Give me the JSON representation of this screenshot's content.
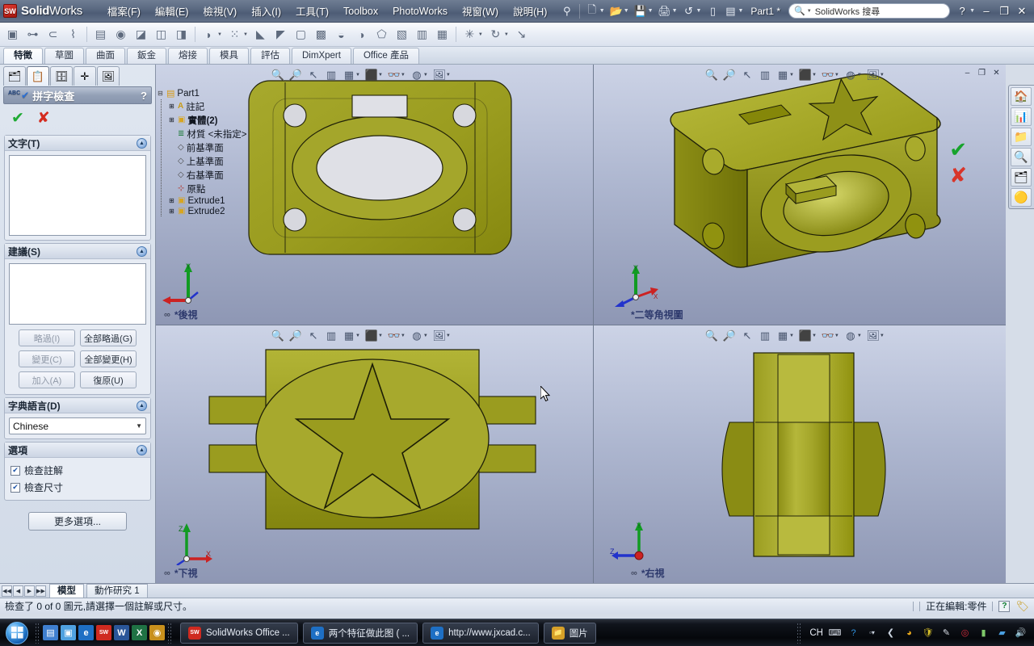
{
  "titlebar": {
    "brand_main": "Solid",
    "brand_light": "Works",
    "logo_text": "SW",
    "menus": [
      {
        "label": "檔案(F)"
      },
      {
        "label": "編輯(E)"
      },
      {
        "label": "檢視(V)"
      },
      {
        "label": "插入(I)"
      },
      {
        "label": "工具(T)"
      },
      {
        "label": "Toolbox"
      },
      {
        "label": "PhotoWorks"
      },
      {
        "label": "視窗(W)"
      },
      {
        "label": "說明(H)"
      }
    ],
    "doc_title": "Part1 *",
    "search_placeholder": "SolidWorks 搜尋",
    "search_value": "SolidWorks 搜尋",
    "quick_icons": [
      "pin-icon",
      "new-document-icon",
      "open-folder-icon",
      "save-icon",
      "print-icon",
      "undo-icon",
      "rebuild-icon",
      "options-icon"
    ],
    "help_label": "?",
    "minimize_label": "–",
    "restore_label": "❐",
    "close_label": "✕"
  },
  "command_toolbar": {
    "icons": [
      "extrude-boss-icon",
      "revolve-boss-icon",
      "swept-boss-icon",
      "lofted-boss-icon",
      "extruded-cut-icon",
      "hole-wizard-icon",
      "revolved-cut-icon",
      "swept-cut-icon",
      "lofted-cut-icon",
      "fillet-icon",
      "linear-pattern-icon",
      "rib-icon",
      "draft-icon",
      "shell-icon",
      "wrap-icon",
      "dome-icon",
      "mirror-icon",
      "reference-geometry-icon",
      "curves-icon",
      "instant3d-icon",
      "move-face-icon",
      "intersect-icon",
      "split-icon",
      "combine-icon"
    ]
  },
  "ribbon_tabs": [
    {
      "label": "特徵",
      "active": true
    },
    {
      "label": "草圖",
      "active": false
    },
    {
      "label": "曲面",
      "active": false
    },
    {
      "label": "鈑金",
      "active": false
    },
    {
      "label": "熔接",
      "active": false
    },
    {
      "label": "模具",
      "active": false
    },
    {
      "label": "評估",
      "active": false
    },
    {
      "label": "DimXpert",
      "active": false
    },
    {
      "label": "Office 產品",
      "active": false
    }
  ],
  "left_panel": {
    "tabs": [
      {
        "name": "feature-manager-tab",
        "icon": "feature-tree-icon",
        "active": false
      },
      {
        "name": "property-manager-tab",
        "icon": "property-clipboard-icon",
        "active": true
      },
      {
        "name": "configuration-manager-tab",
        "icon": "configuration-icon",
        "active": false
      },
      {
        "name": "dimxpert-manager-tab",
        "icon": "dimxpert-target-icon",
        "active": false
      },
      {
        "name": "display-manager-tab",
        "icon": "display-image-icon",
        "active": false
      }
    ],
    "pm_title": "拼字檢查",
    "pm_abc": "ABC",
    "pm_help": "?",
    "ok_label": "✔",
    "cancel_label": "✘",
    "groups": {
      "text": {
        "title": "文字(T)",
        "value": ""
      },
      "suggestions": {
        "title": "建議(S)",
        "value": "",
        "buttons": [
          {
            "label": "略過(I)",
            "dim": true
          },
          {
            "label": "全部略過(G)",
            "dim": false
          },
          {
            "label": "變更(C)",
            "dim": true
          },
          {
            "label": "全部變更(H)",
            "dim": false
          },
          {
            "label": "加入(A)",
            "dim": true
          },
          {
            "label": "復原(U)",
            "dim": false
          }
        ]
      },
      "dictionary": {
        "title": "字典語言(D)",
        "selected": "Chinese"
      },
      "options": {
        "title": "選項",
        "items": [
          {
            "label": "檢查註解",
            "checked": true
          },
          {
            "label": "檢查尺寸",
            "checked": true
          }
        ],
        "more_button": "更多選項..."
      }
    }
  },
  "feature_tree": {
    "root": "Part1",
    "nodes": [
      {
        "label": "註記",
        "icon": "annotations-icon",
        "expandable": true
      },
      {
        "label": "實體(2)",
        "icon": "solid-bodies-icon",
        "expandable": true
      },
      {
        "label": "材質 <未指定>",
        "icon": "material-icon",
        "expandable": false
      },
      {
        "label": "前基準面",
        "icon": "plane-icon",
        "expandable": false
      },
      {
        "label": "上基準面",
        "icon": "plane-icon",
        "expandable": false
      },
      {
        "label": "右基準面",
        "icon": "plane-icon",
        "expandable": false
      },
      {
        "label": "原點",
        "icon": "origin-icon",
        "expandable": false
      },
      {
        "label": "Extrude1",
        "icon": "extrude-feature-icon",
        "expandable": true
      },
      {
        "label": "Extrude2",
        "icon": "extrude-feature-icon",
        "expandable": true
      }
    ]
  },
  "viewports": [
    {
      "name": "viewport-back",
      "label": "*後視",
      "linked": true,
      "toolbar": [
        "zoom-to-fit-icon",
        "zoom-to-area-icon",
        "zoom-previous-icon",
        "section-view-icon",
        "view-orientation-icon",
        "display-style-icon",
        "hide-show-icon",
        "appearance-icon",
        "scene-icon"
      ]
    },
    {
      "name": "viewport-isometric",
      "label": "*二等角視圖",
      "linked": false,
      "toolbar": [
        "zoom-to-fit-icon",
        "zoom-to-area-icon",
        "zoom-previous-icon",
        "section-view-icon",
        "view-orientation-icon",
        "display-style-icon",
        "hide-show-icon",
        "appearance-icon",
        "scene-icon"
      ]
    },
    {
      "name": "viewport-bottom",
      "label": "*下視",
      "linked": true,
      "toolbar": [
        "zoom-to-fit-icon",
        "zoom-to-area-icon",
        "zoom-previous-icon",
        "section-view-icon",
        "view-orientation-icon",
        "display-style-icon",
        "hide-show-icon",
        "appearance-icon",
        "scene-icon"
      ]
    },
    {
      "name": "viewport-right",
      "label": "*右視",
      "linked": true,
      "toolbar": [
        "zoom-to-fit-icon",
        "zoom-to-area-icon",
        "zoom-previous-icon",
        "section-view-icon",
        "view-orientation-icon",
        "display-style-icon",
        "hide-show-icon",
        "appearance-icon",
        "scene-icon"
      ]
    }
  ],
  "viewport_window_buttons": {
    "minimize": "–",
    "restore": "❐",
    "close": "✕"
  },
  "triad_labels": {
    "x": "X",
    "y": "Y",
    "z": "Z"
  },
  "right_sidebar": [
    {
      "name": "solidworks-resources-icon",
      "glyph": "🏠"
    },
    {
      "name": "design-library-icon",
      "glyph": "📚"
    },
    {
      "name": "file-explorer-icon",
      "glyph": "📂"
    },
    {
      "name": "search-icon",
      "glyph": "🔎"
    },
    {
      "name": "view-palette-icon",
      "glyph": "🗂"
    },
    {
      "name": "appearances-scenes-icon",
      "glyph": "🟡"
    }
  ],
  "bottom_tabs": [
    {
      "label": "模型",
      "active": true
    },
    {
      "label": "動作研究 1",
      "active": false
    }
  ],
  "statusbar": {
    "message": "檢查了 0 of 0 圖元,請選擇一個註解或尺寸。",
    "edit_state": "正在編輯:零件",
    "help_glyph": "?"
  },
  "taskbar": {
    "start_label": "",
    "quick_launch": [
      {
        "name": "show-desktop-icon",
        "glyph": "▤",
        "color": "#3f7fcf"
      },
      {
        "name": "flip-3d-icon",
        "glyph": "▣",
        "color": "#4fa1e0"
      },
      {
        "name": "internet-explorer-icon",
        "glyph": "e",
        "color": "#1e6fc4"
      },
      {
        "name": "solidworks-icon",
        "glyph": "SW",
        "color": "#cf2a20"
      },
      {
        "name": "word-icon",
        "glyph": "W",
        "color": "#2a5699"
      },
      {
        "name": "excel-icon",
        "glyph": "X",
        "color": "#1f7244"
      },
      {
        "name": "media-icon",
        "glyph": "◉",
        "color": "#c8901c"
      }
    ],
    "tasks": [
      {
        "label": "SolidWorks Office ...",
        "icon": "solidworks-icon",
        "active": true
      },
      {
        "label": "两个特征做此图 ( ...",
        "icon": "internet-explorer-icon",
        "active": false
      },
      {
        "label": "http://www.jxcad.c...",
        "icon": "internet-explorer-icon",
        "active": false
      },
      {
        "label": "圖片",
        "icon": "folder-icon",
        "active": false
      }
    ],
    "tray": {
      "ime": "CH",
      "icons": [
        "keyboard-icon",
        "help-icon",
        "show-hidden-icons-icon",
        "chevron-left-icon",
        "antivirus-icon",
        "shield-icon",
        "pen-icon",
        "opera-icon",
        "battery-icon",
        "network-icon",
        "volume-icon"
      ]
    }
  },
  "colors": {
    "model_olive": "#9a9c1f",
    "model_olive_dark": "#6f7112",
    "model_olive_light": "#c3c64a",
    "viewport_bg_top": "#ccd3e6",
    "viewport_bg_bottom": "#8e97b4",
    "accent_blue": "#2a6fd4",
    "ok_green": "#17a32c",
    "cancel_red": "#d8352a"
  }
}
